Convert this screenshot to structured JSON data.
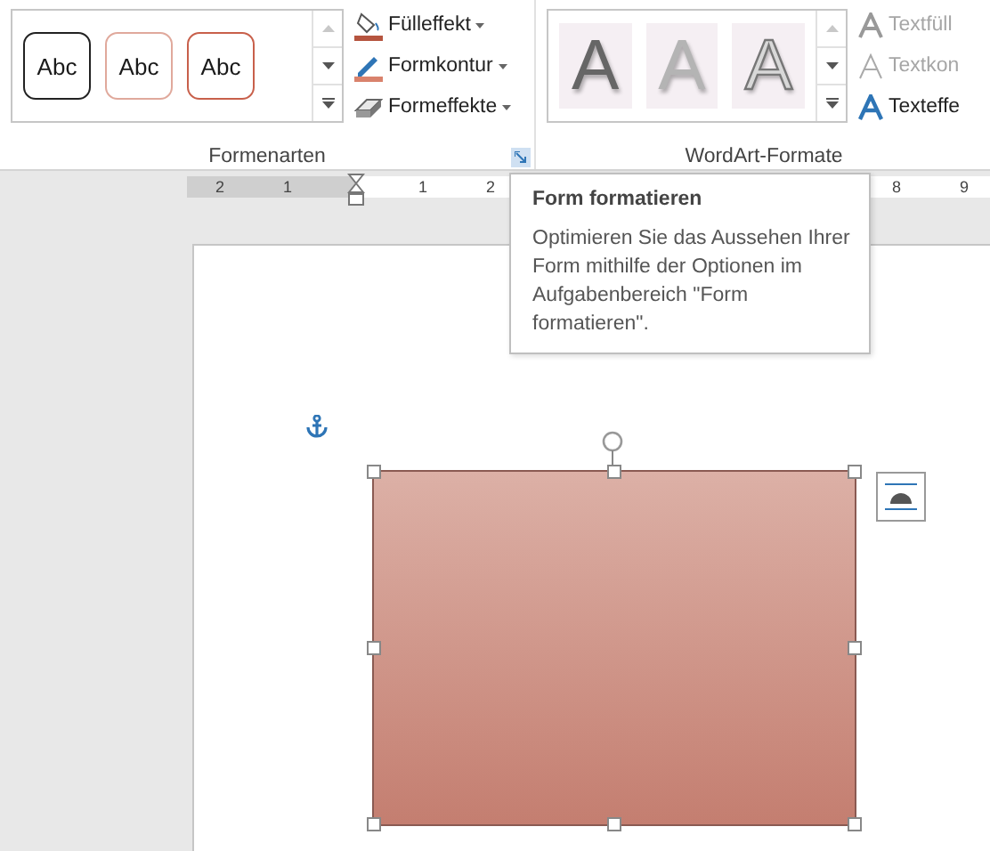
{
  "ribbon": {
    "groups": [
      {
        "kind": "shape-styles",
        "label": "Formenarten",
        "styles": [
          {
            "text": "Abc",
            "kind": "dark"
          },
          {
            "text": "Abc",
            "kind": "light"
          },
          {
            "text": "Abc",
            "kind": "accent"
          }
        ],
        "commands": [
          {
            "label": "Fülleffekt",
            "kind": "fill",
            "disabled": false,
            "dropdown": true
          },
          {
            "label": "Formkontur",
            "kind": "outline",
            "disabled": false,
            "dropdown": true
          },
          {
            "label": "Formeffekte",
            "kind": "effects",
            "disabled": false,
            "dropdown": true
          }
        ]
      },
      {
        "kind": "wordart",
        "label": "WordArt-Formate",
        "styles": [
          {
            "text": "A",
            "kind": "dark"
          },
          {
            "text": "A",
            "kind": "light"
          },
          {
            "text": "A",
            "kind": "outline"
          }
        ],
        "commands": [
          {
            "label": "Textfüll",
            "kind": "text-fill",
            "disabled": true,
            "dropdown": false
          },
          {
            "label": "Textkon",
            "kind": "text-outline",
            "disabled": true,
            "dropdown": false
          },
          {
            "label": "Texteffe",
            "kind": "text-effects",
            "disabled": false,
            "dropdown": false
          }
        ]
      }
    ]
  },
  "ruler": {
    "labels": [
      "2",
      "1",
      "1",
      "2",
      "8",
      "9"
    ]
  },
  "tooltip": {
    "title": "Form formatieren",
    "body": "Optimieren Sie das Aussehen Ihrer Form mithilfe der Optionen im Aufgabenbereich \"Form formatieren\"."
  }
}
